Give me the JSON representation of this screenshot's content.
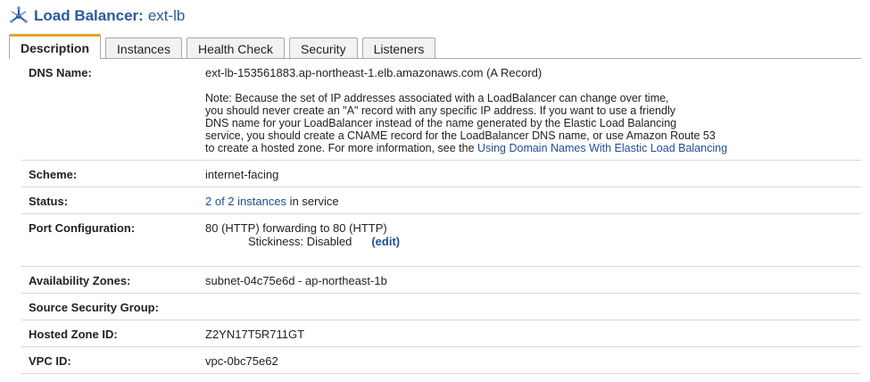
{
  "header": {
    "title_label": "Load Balancer:",
    "title_name": "ext-lb",
    "icon": "load-balancer-icon"
  },
  "tabs": [
    {
      "label": "Description",
      "active": true
    },
    {
      "label": "Instances",
      "active": false
    },
    {
      "label": "Health Check",
      "active": false
    },
    {
      "label": "Security",
      "active": false
    },
    {
      "label": "Listeners",
      "active": false
    }
  ],
  "details": {
    "dns_name": {
      "label": "DNS Name:",
      "value": "ext-lb-153561883.ap-northeast-1.elb.amazonaws.com (A Record)",
      "note_lines": [
        "Note: Because the set of IP addresses associated with a LoadBalancer can change over time,",
        "you should never create an \"A\" record with any specific IP address. If you want to use a friendly",
        "DNS name for your LoadBalancer instead of the name generated by the Elastic Load Balancing",
        "service, you should create a CNAME record for the LoadBalancer DNS name, or use Amazon Route 53"
      ],
      "note_last_prefix": "to create a hosted zone. For more information, see the ",
      "note_link": "Using Domain Names With Elastic Load Balancing"
    },
    "scheme": {
      "label": "Scheme:",
      "value": "internet-facing"
    },
    "status": {
      "label": "Status:",
      "link": "2 of 2 instances",
      "suffix": " in service"
    },
    "port_configuration": {
      "label": "Port Configuration:",
      "value": "80 (HTTP) forwarding to 80 (HTTP)",
      "stickiness": "Stickiness: Disabled",
      "edit_link": "(edit)"
    },
    "availability_zones": {
      "label": "Availability Zones:",
      "value": "subnet-04c75e6d - ap-northeast-1b"
    },
    "source_security_group": {
      "label": "Source Security Group:",
      "value": ""
    },
    "hosted_zone_id": {
      "label": "Hosted Zone ID:",
      "value": "Z2YN17T5R711GT"
    },
    "vpc_id": {
      "label": "VPC ID:",
      "value": "vpc-0bc75e62"
    }
  },
  "colors": {
    "accent": "#2a5a9c",
    "link": "#1f4e96",
    "active_tab_top": "#e0a52a"
  }
}
